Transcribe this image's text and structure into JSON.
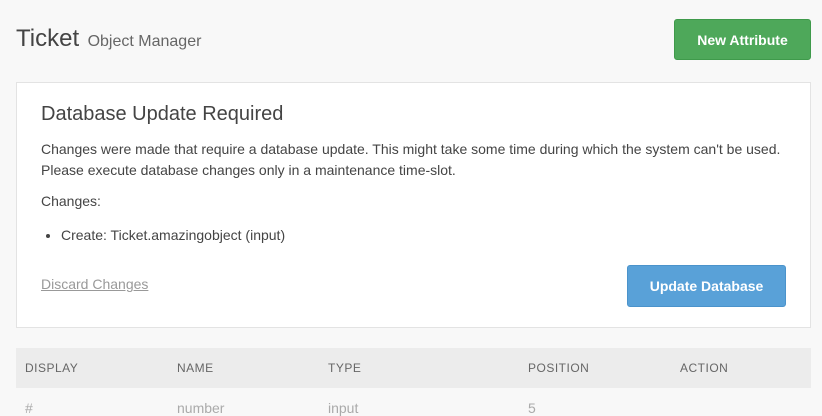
{
  "header": {
    "title": "Ticket",
    "subtitle": "Object Manager",
    "new_attribute_label": "New Attribute"
  },
  "alert": {
    "title": "Database Update Required",
    "description": "Changes were made that require a database update. This might take some time during which the system can't be used. Please execute database changes only in a maintenance time-slot.",
    "changes_label": "Changes:",
    "changes": [
      "Create: Ticket.amazingobject (input)"
    ],
    "discard_label": "Discard Changes",
    "update_label": "Update Database"
  },
  "table": {
    "columns": [
      "DISPLAY",
      "NAME",
      "TYPE",
      "POSITION",
      "ACTION"
    ],
    "rows": [
      [
        "#",
        "number",
        "input",
        "5",
        ""
      ]
    ]
  },
  "colors": {
    "new_attribute_button": "#4ea85a",
    "update_button": "#59a1d8",
    "background": "#f8f8f8"
  }
}
